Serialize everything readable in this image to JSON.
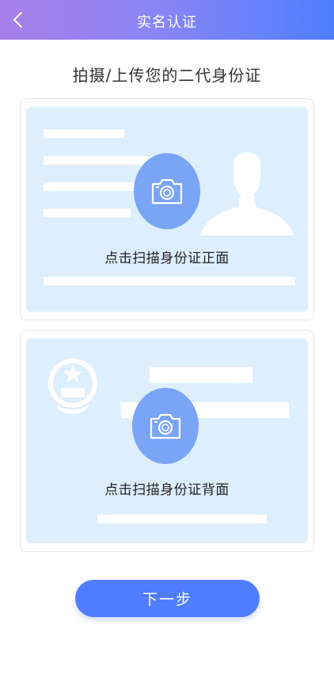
{
  "header": {
    "title": "实名认证",
    "back_icon": "chevron-left-icon",
    "gradient_start": "#a87fe8",
    "gradient_end": "#4f7dff"
  },
  "subtitle": "拍摄/上传您的二代身份证",
  "cards": [
    {
      "label": "点击扫描身份证正面",
      "icon": "camera-icon",
      "illustration": "portrait-silhouette-icon"
    },
    {
      "label": "点击扫描身份证背面",
      "icon": "camera-icon",
      "illustration": "national-emblem-icon"
    }
  ],
  "next_button": {
    "label": "下一步",
    "color": "#4f7dff"
  },
  "colors": {
    "card_background": "#ddeefd",
    "camera_circle": "#7aa4f6"
  }
}
